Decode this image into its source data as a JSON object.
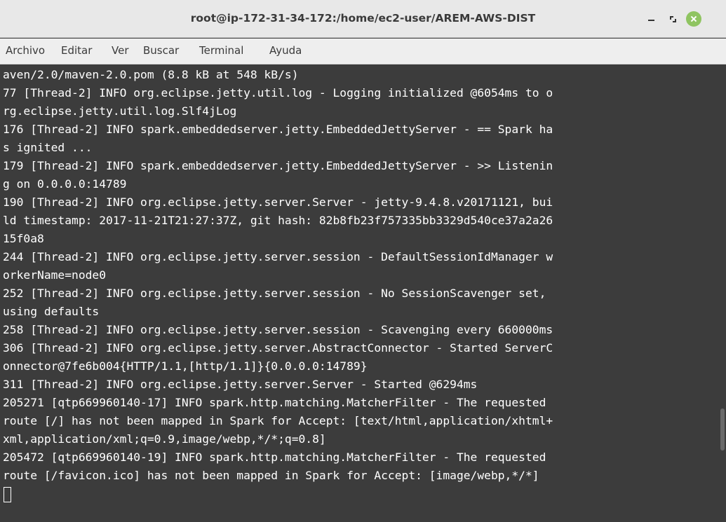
{
  "window": {
    "title": "root@ip-172-31-34-172:/home/ec2-user/AREM-AWS-DIST"
  },
  "menu": [
    {
      "label": "Archivo"
    },
    {
      "label": "Editar"
    },
    {
      "label": "Ver"
    },
    {
      "label": "Buscar"
    },
    {
      "label": "Terminal"
    },
    {
      "label": "Ayuda"
    }
  ],
  "terminal": {
    "lines": [
      "aven/2.0/maven-2.0.pom (8.8 kB at 548 kB/s)",
      "77 [Thread-2] INFO org.eclipse.jetty.util.log - Logging initialized @6054ms to o",
      "rg.eclipse.jetty.util.log.Slf4jLog",
      "176 [Thread-2] INFO spark.embeddedserver.jetty.EmbeddedJettyServer - == Spark ha",
      "s ignited ...",
      "179 [Thread-2] INFO spark.embeddedserver.jetty.EmbeddedJettyServer - >> Listenin",
      "g on 0.0.0.0:14789",
      "190 [Thread-2] INFO org.eclipse.jetty.server.Server - jetty-9.4.8.v20171121, bui",
      "ld timestamp: 2017-11-21T21:27:37Z, git hash: 82b8fb23f757335bb3329d540ce37a2a26",
      "15f0a8",
      "244 [Thread-2] INFO org.eclipse.jetty.server.session - DefaultSessionIdManager w",
      "orkerName=node0",
      "252 [Thread-2] INFO org.eclipse.jetty.server.session - No SessionScavenger set,",
      "using defaults",
      "258 [Thread-2] INFO org.eclipse.jetty.server.session - Scavenging every 660000ms",
      "306 [Thread-2] INFO org.eclipse.jetty.server.AbstractConnector - Started ServerC",
      "onnector@7fe6b004{HTTP/1.1,[http/1.1]}{0.0.0.0:14789}",
      "311 [Thread-2] INFO org.eclipse.jetty.server.Server - Started @6294ms",
      "205271 [qtp669960140-17] INFO spark.http.matching.MatcherFilter - The requested",
      "route [/] has not been mapped in Spark for Accept: [text/html,application/xhtml+",
      "xml,application/xml;q=0.9,image/webp,*/*;q=0.8]",
      "205472 [qtp669960140-19] INFO spark.http.matching.MatcherFilter - The requested",
      "route [/favicon.ico] has not been mapped in Spark for Accept: [image/webp,*/*]"
    ]
  }
}
